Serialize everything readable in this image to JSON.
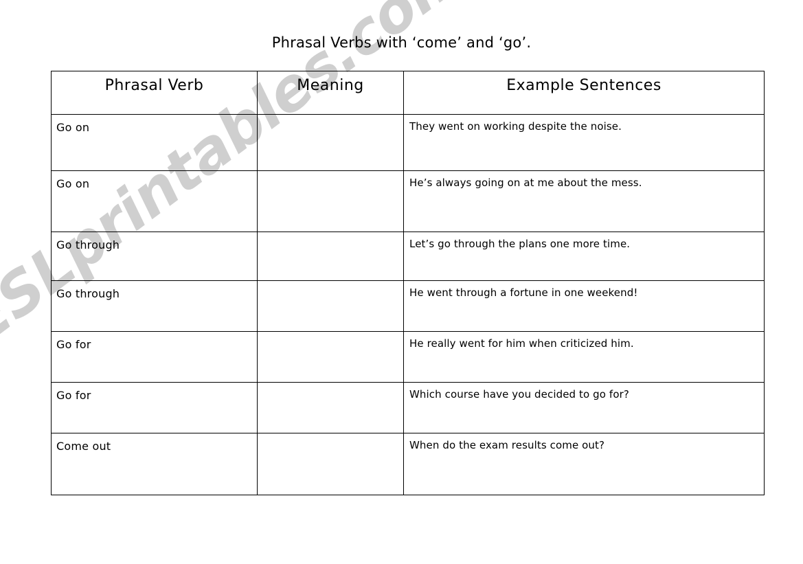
{
  "page": {
    "title": "Phrasal Verbs with ‘come’ and ‘go’.",
    "background_color": "#ffffff",
    "text_color": "#000000"
  },
  "watermark": {
    "text": "ESLprintables.com",
    "color": "#cfcfcf"
  },
  "table": {
    "headers": {
      "col1": "Phrasal Verb",
      "col2": "Meaning",
      "col3": "Example Sentences"
    },
    "rows": [
      {
        "verb": "Go on",
        "meaning": "",
        "example": "They went on working despite the noise."
      },
      {
        "verb": "Go on",
        "meaning": "",
        "example": "He’s always going on at me about the mess."
      },
      {
        "verb": "Go through",
        "meaning": "",
        "example": "Let’s go through the plans one more time."
      },
      {
        "verb": "Go through",
        "meaning": "",
        "example": "He went through a fortune in one weekend!"
      },
      {
        "verb": "Go for",
        "meaning": "",
        "example": "He really went for him when criticized him."
      },
      {
        "verb": "Go for",
        "meaning": "",
        "example": "Which course have you decided to go for?"
      },
      {
        "verb": "Come out",
        "meaning": "",
        "example": "When do the exam results come out?"
      }
    ]
  }
}
